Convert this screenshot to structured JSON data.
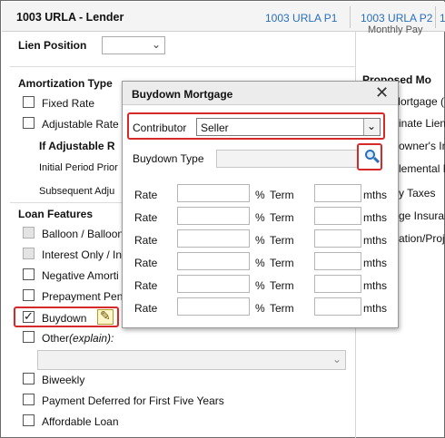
{
  "header": {
    "title": "1003 URLA - Lender",
    "tabs": [
      "1003 URLA P1",
      "1003 URLA P2",
      "1003"
    ],
    "right_peek": "Monthly Pay"
  },
  "lien": {
    "label": "Lien Position",
    "value": ""
  },
  "amortization": {
    "heading": "Amortization Type",
    "fixed": "Fixed Rate",
    "adjustable": "Adjustable Rate",
    "if_adjustable": "If Adjustable R",
    "initial_period": "Initial Period Prior",
    "subsequent": "Subsequent Adju"
  },
  "loan_features": {
    "heading": "Loan Features",
    "balloon": "Balloon / Balloon",
    "interest_only": "Interest Only / In",
    "negative_amort": "Negative Amorti",
    "prepayment": "Prepayment Pen",
    "buydown": "Buydown",
    "other_label": "Other",
    "other_explain": "(explain):",
    "biweekly": "Biweekly",
    "payment_deferred": "Payment Deferred for First Five Years",
    "affordable": "Affordable Loan"
  },
  "right_panel": {
    "heading": "Proposed Mo",
    "lines": [
      "Mortgage (P",
      "inate Lien",
      "owner's Ins",
      "lemental Pro",
      "y Taxes",
      "ge Insurance",
      "ation/Proj"
    ]
  },
  "dialog": {
    "title": "Buydown Mortgage",
    "contributor_label": "Contributor",
    "contributor_value": "Seller",
    "type_label": "Buydown Type",
    "rate_label": "Rate",
    "pct": "%",
    "term_label": "Term",
    "mths": "mths"
  },
  "icons": [
    "chevron-down-icon",
    "close-icon",
    "search-icon",
    "edit-icon",
    "checkbox-icon"
  ],
  "colors": {
    "link": "#2a6fb8",
    "highlight": "#d62a2a",
    "search": "#2c6fb9"
  }
}
